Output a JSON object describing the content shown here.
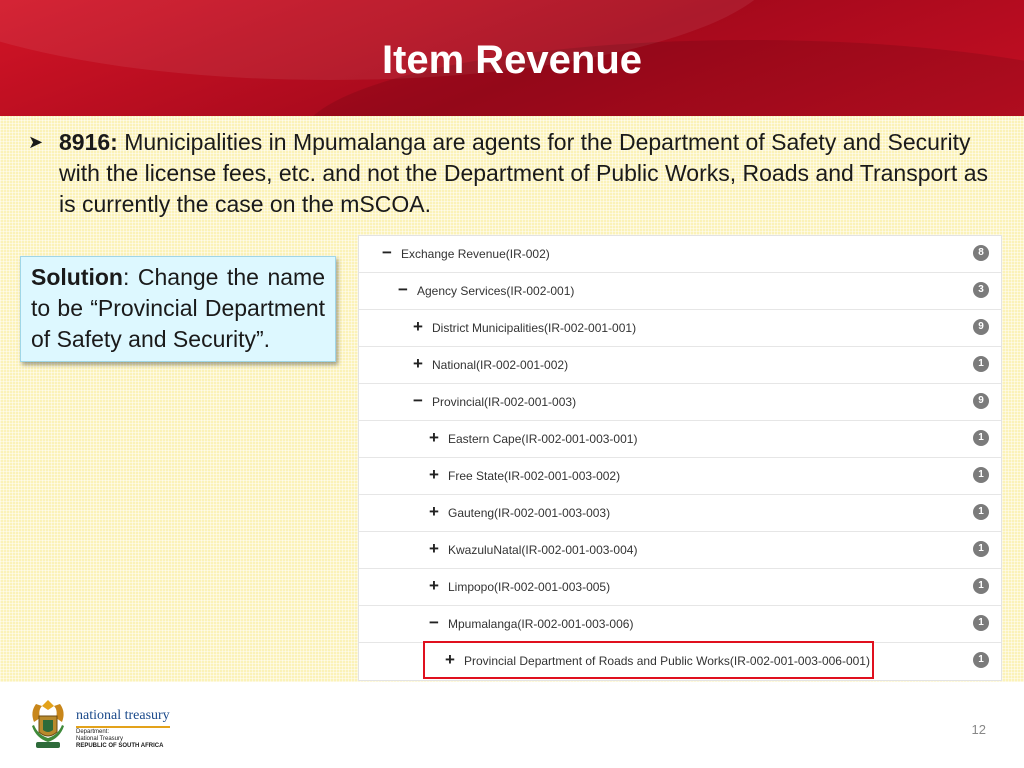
{
  "slide": {
    "title": "Item Revenue",
    "bullet": {
      "code": "8916:",
      "text": "Municipalities in Mpumalanga are agents for the Department of Safety and Security with the license fees, etc. and not the Department of Public Works, Roads and Transport as is currently the case on the mSCOA."
    },
    "solution": {
      "label": "Solution",
      "text": ": Change the name to be “Provincial Department of Safety and Security”."
    },
    "page_number": "12"
  },
  "tree": {
    "rows": [
      {
        "toggle": "−",
        "label": "Exchange Revenue(IR-002)",
        "count": "8"
      },
      {
        "toggle": "−",
        "label": "Agency Services(IR-002-001)",
        "count": "3"
      },
      {
        "toggle": "+",
        "label": "District Municipalities(IR-002-001-001)",
        "count": "9"
      },
      {
        "toggle": "+",
        "label": "National(IR-002-001-002)",
        "count": "1"
      },
      {
        "toggle": "−",
        "label": "Provincial(IR-002-001-003)",
        "count": "9"
      },
      {
        "toggle": "+",
        "label": "Eastern Cape(IR-002-001-003-001)",
        "count": "1"
      },
      {
        "toggle": "+",
        "label": "Free State(IR-002-001-003-002)",
        "count": "1"
      },
      {
        "toggle": "+",
        "label": "Gauteng(IR-002-001-003-003)",
        "count": "1"
      },
      {
        "toggle": "+",
        "label": "KwazuluNatal(IR-002-001-003-004)",
        "count": "1"
      },
      {
        "toggle": "+",
        "label": "Limpopo(IR-002-001-003-005)",
        "count": "1"
      },
      {
        "toggle": "−",
        "label": "Mpumalanga(IR-002-001-003-006)",
        "count": "1"
      },
      {
        "toggle": "+",
        "label": "Provincial Department of Roads and Public Works(IR-002-001-003-006-001)",
        "count": "1"
      }
    ]
  },
  "logo": {
    "name": "national treasury",
    "line1": "Department:",
    "line2": "National Treasury",
    "line3": "REPUBLIC OF SOUTH AFRICA"
  },
  "colors": {
    "header_red": "#b40d20",
    "content_yellow": "#fbf2b8",
    "solution_bg": "#ddf8ff",
    "highlight_red": "#e0101e",
    "brand_blue": "#1b4a8b"
  },
  "icons": {
    "bullet": "arrow-bullet-icon",
    "expanded": "minus-icon",
    "collapsed": "plus-icon",
    "crest": "coat-of-arms-icon"
  }
}
